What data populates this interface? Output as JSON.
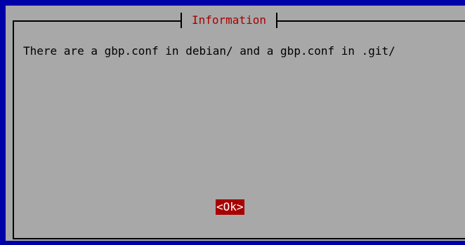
{
  "dialog": {
    "title": "Information",
    "message": "There are a gbp.conf in debian/ and a gbp.conf in .git/",
    "ok_label": "<Ok>"
  },
  "colors": {
    "screen_background": "#0000a8",
    "dialog_background": "#a8a8a8",
    "title_text": "#a80000",
    "button_active_background": "#a80000",
    "button_active_text": "#ffffff"
  }
}
